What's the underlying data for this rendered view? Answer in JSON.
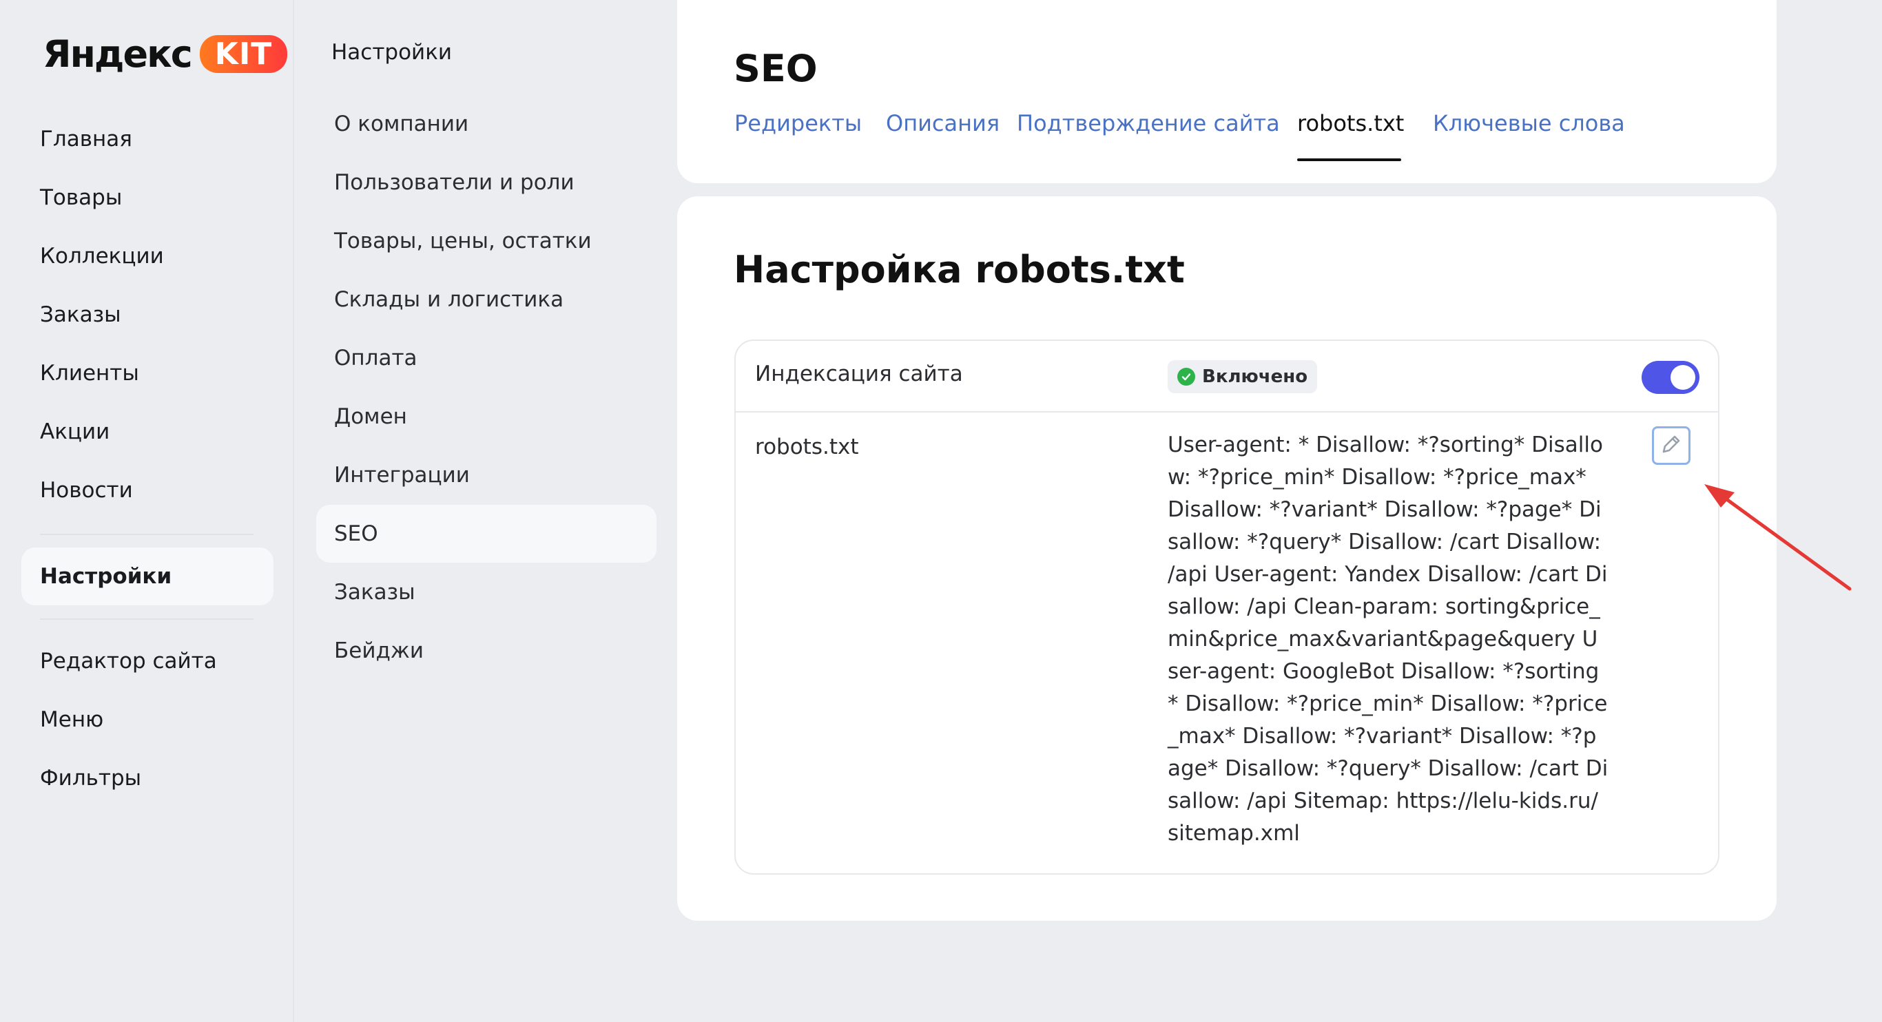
{
  "brand": {
    "name": "Яндекс",
    "badge": "KIT"
  },
  "sidebar": {
    "items": [
      {
        "label": "Главная"
      },
      {
        "label": "Товары"
      },
      {
        "label": "Коллекции"
      },
      {
        "label": "Заказы"
      },
      {
        "label": "Клиенты"
      },
      {
        "label": "Акции"
      },
      {
        "label": "Новости"
      },
      {
        "label": "Настройки",
        "active": true
      },
      {
        "label": "Редактор сайта"
      },
      {
        "label": "Меню"
      },
      {
        "label": "Фильтры"
      }
    ]
  },
  "settings_menu": {
    "title": "Настройки",
    "items": [
      {
        "label": "О компании"
      },
      {
        "label": "Пользователи и роли"
      },
      {
        "label": "Товары, цены, остатки"
      },
      {
        "label": "Склады и логистика"
      },
      {
        "label": "Оплата"
      },
      {
        "label": "Домен"
      },
      {
        "label": "Интеграции"
      },
      {
        "label": "SEO",
        "active": true
      },
      {
        "label": "Заказы"
      },
      {
        "label": "Бейджи"
      }
    ]
  },
  "header": {
    "title": "SEO",
    "tabs": [
      {
        "label": "Редиректы"
      },
      {
        "label": "Описания"
      },
      {
        "label": "Подтверждение сайта"
      },
      {
        "label": "robots.txt",
        "active": true
      },
      {
        "label": "Ключевые слова"
      }
    ]
  },
  "main": {
    "section_title": "Настройка robots.txt",
    "indexing": {
      "label": "Индексация сайта",
      "status": "Включено",
      "enabled": true
    },
    "robots": {
      "label": "robots.txt",
      "content": "User-agent: * Disallow: *?sorting* Disallow: *?price_min* Disallow: *?price_max* Disallow: *?variant* Disallow: *?page* Disallow: *?query* Disallow: /cart Disallow: /api User-agent: Yandex Disallow: /cart Disallow: /api Clean-param: sorting&price_min&price_max&variant&page&query User-agent: GoogleBot Disallow: *?sorting* Disallow: *?price_min* Disallow: *?price_max* Disallow: *?variant* Disallow: *?page* Disallow: *?query* Disallow: /cart Disallow: /api Sitemap: https://lelu-kids.ru/sitemap.xml",
      "edit_icon": "pencil-icon"
    }
  },
  "colors": {
    "accent": "#4f55e6",
    "link": "#4a72c4",
    "success": "#2eb34b",
    "annotation_arrow": "#e53935"
  }
}
